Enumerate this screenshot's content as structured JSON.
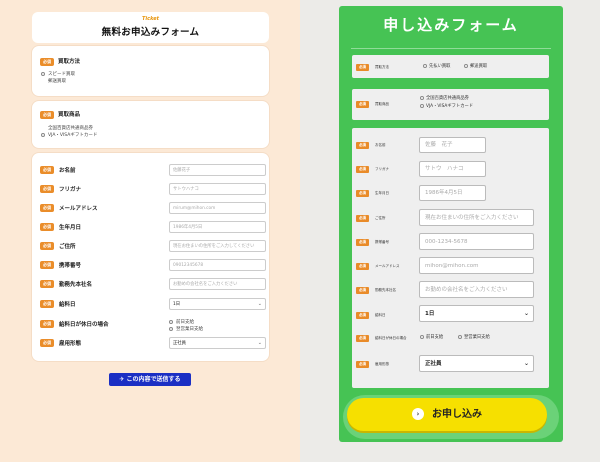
{
  "left": {
    "logo": "Ticket",
    "title": "無料お申込みフォーム",
    "required": "必須",
    "method_label": "買取方法",
    "method_options": [
      "スピード買取",
      "郵送買取"
    ],
    "product_label": "買取商品",
    "product_options": [
      "全国百貨店共通商品券",
      "VJA・VISAギフトカード"
    ],
    "fields": [
      {
        "label": "お名前",
        "placeholder": "佐藤花子"
      },
      {
        "label": "フリガナ",
        "placeholder": "サトウハナコ"
      },
      {
        "label": "メールアドレス",
        "placeholder": "mirum@mihon.com"
      },
      {
        "label": "生年月日",
        "placeholder": "1986年4月5日"
      },
      {
        "label": "ご住所",
        "placeholder": "現在お住まいの住所をご入力してください"
      },
      {
        "label": "携帯番号",
        "placeholder": "09012345678"
      },
      {
        "label": "勤務先本社名",
        "placeholder": "お勤めの会社名をご入力ください"
      },
      {
        "label": "給料日",
        "value": "1日"
      }
    ],
    "holiday_label": "給料日が休日の場合",
    "holiday_options": [
      "前日支給",
      "翌営業日支給"
    ],
    "employment_label": "雇用形態",
    "employment_value": "正社員",
    "submit": "この内容で送信する"
  },
  "right": {
    "title": "申し込みフォーム",
    "required": "必須",
    "method_label": "買取方法",
    "method_options": [
      "先払い買取",
      "郵送買取"
    ],
    "product_label": "買取商品",
    "product_options": [
      "全国百貨店共通商品券",
      "VJA・VISAギフトカード"
    ],
    "fields": [
      {
        "label": "お名前",
        "placeholder": "佐藤　花子"
      },
      {
        "label": "フリガナ",
        "placeholder": "サトウ　ハナコ"
      },
      {
        "label": "生年月日",
        "placeholder": "1986年4月5日"
      },
      {
        "label": "ご住所",
        "placeholder": "現在お住まいの住所をご入力ください"
      },
      {
        "label": "携帯番号",
        "placeholder": "000-1234-5678"
      },
      {
        "label": "メールアドレス",
        "placeholder": "mihon@mihon.com"
      },
      {
        "label": "勤務先本社名",
        "placeholder": "お勤めの会社名をご入力ください"
      },
      {
        "label": "給料日",
        "value": "1日"
      }
    ],
    "holiday_label": "給料日が休日の場合",
    "holiday_options": [
      "前日支給",
      "翌営業日支給"
    ],
    "employment_label": "雇用形態",
    "employment_value": "正社員",
    "submit": "お申し込み"
  }
}
